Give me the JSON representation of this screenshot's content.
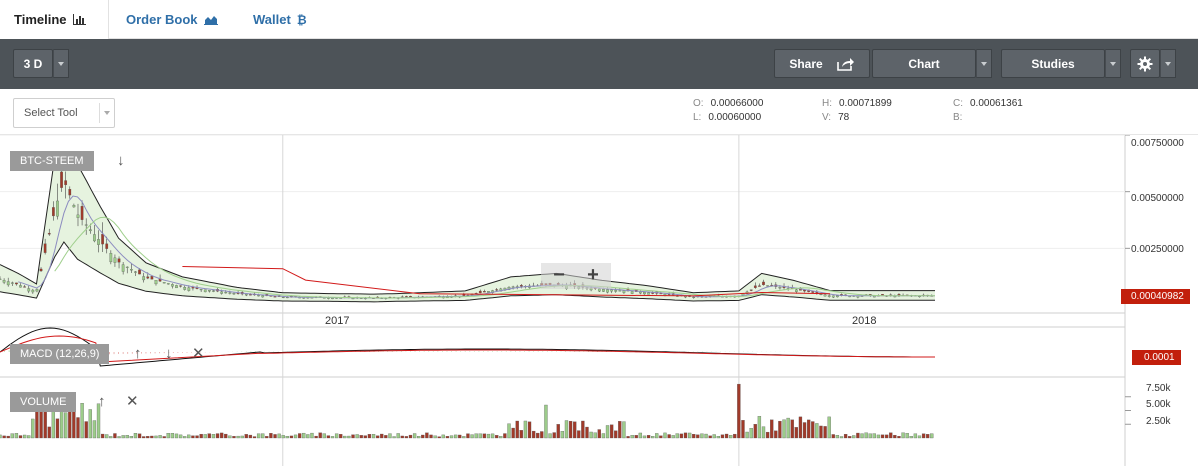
{
  "tabs": [
    {
      "label": "Timeline",
      "icon": "bar-chart-icon",
      "active": true
    },
    {
      "label": "Order Book",
      "icon": "area-chart-icon",
      "active": false
    },
    {
      "label": "Wallet",
      "icon": "bitcoin-icon",
      "active": false
    }
  ],
  "toolbar": {
    "period": "3 D",
    "share_label": "Share",
    "chart_label": "Chart",
    "studies_label": "Studies",
    "settings_icon": "gear-icon",
    "share_icon": "share-icon"
  },
  "select_tool": {
    "label": "Select Tool"
  },
  "ohlc": {
    "o_key": "O:",
    "o_val": "0.00066000",
    "h_key": "H:",
    "h_val": "0.00071899",
    "c_key": "C:",
    "c_val": "0.00061361",
    "l_key": "L:",
    "l_val": "0.00060000",
    "v_key": "V:",
    "v_val": "78",
    "b_key": "B:",
    "b_val": ""
  },
  "panels": {
    "main_label": "BTC-STEEM",
    "macd_label": "MACD (12,26,9)",
    "volume_label": "VOLUME"
  },
  "price_axis": [
    "0.00750000",
    "0.00500000",
    "0.00250000"
  ],
  "last_price": "0.00040982",
  "macd_value": "0.0001",
  "volume_axis": [
    "7.50k",
    "5.00k",
    "2.50k"
  ],
  "time_axis": [
    "2017",
    "2018"
  ],
  "zoom": {
    "minus": "−",
    "plus": "+"
  },
  "colors": {
    "up": "#9ccc8a",
    "down": "#a03a2a",
    "accent": "#c21f0c",
    "toolbar": "#4d5358",
    "link": "#2f6fa8"
  },
  "chart_data": {
    "type": "candlestick",
    "title": "BTC-STEEM",
    "ylim": [
      0,
      0.0075
    ],
    "close_series": [
      [
        2016.38,
        0.00115
      ],
      [
        2016.42,
        0.0009
      ],
      [
        2016.46,
        0.0006
      ],
      [
        2016.5,
        0.0042
      ],
      [
        2016.52,
        0.0055
      ],
      [
        2016.55,
        0.004
      ],
      [
        2016.6,
        0.0028
      ],
      [
        2016.64,
        0.0019
      ],
      [
        2016.7,
        0.0012
      ],
      [
        2016.78,
        0.0008
      ],
      [
        2016.9,
        0.0005
      ],
      [
        2017.0,
        0.00035
      ],
      [
        2017.2,
        0.0003
      ],
      [
        2017.4,
        0.0004
      ],
      [
        2017.5,
        0.0008
      ],
      [
        2017.6,
        0.0009
      ],
      [
        2017.7,
        0.0007
      ],
      [
        2017.8,
        0.00055
      ],
      [
        2017.9,
        0.00035
      ],
      [
        2018.0,
        0.0004
      ],
      [
        2018.05,
        0.0009
      ],
      [
        2018.12,
        0.0007
      ],
      [
        2018.2,
        0.00041
      ]
    ],
    "macd_value": 0.0001,
    "volume_ylim": [
      0,
      10000
    ]
  }
}
